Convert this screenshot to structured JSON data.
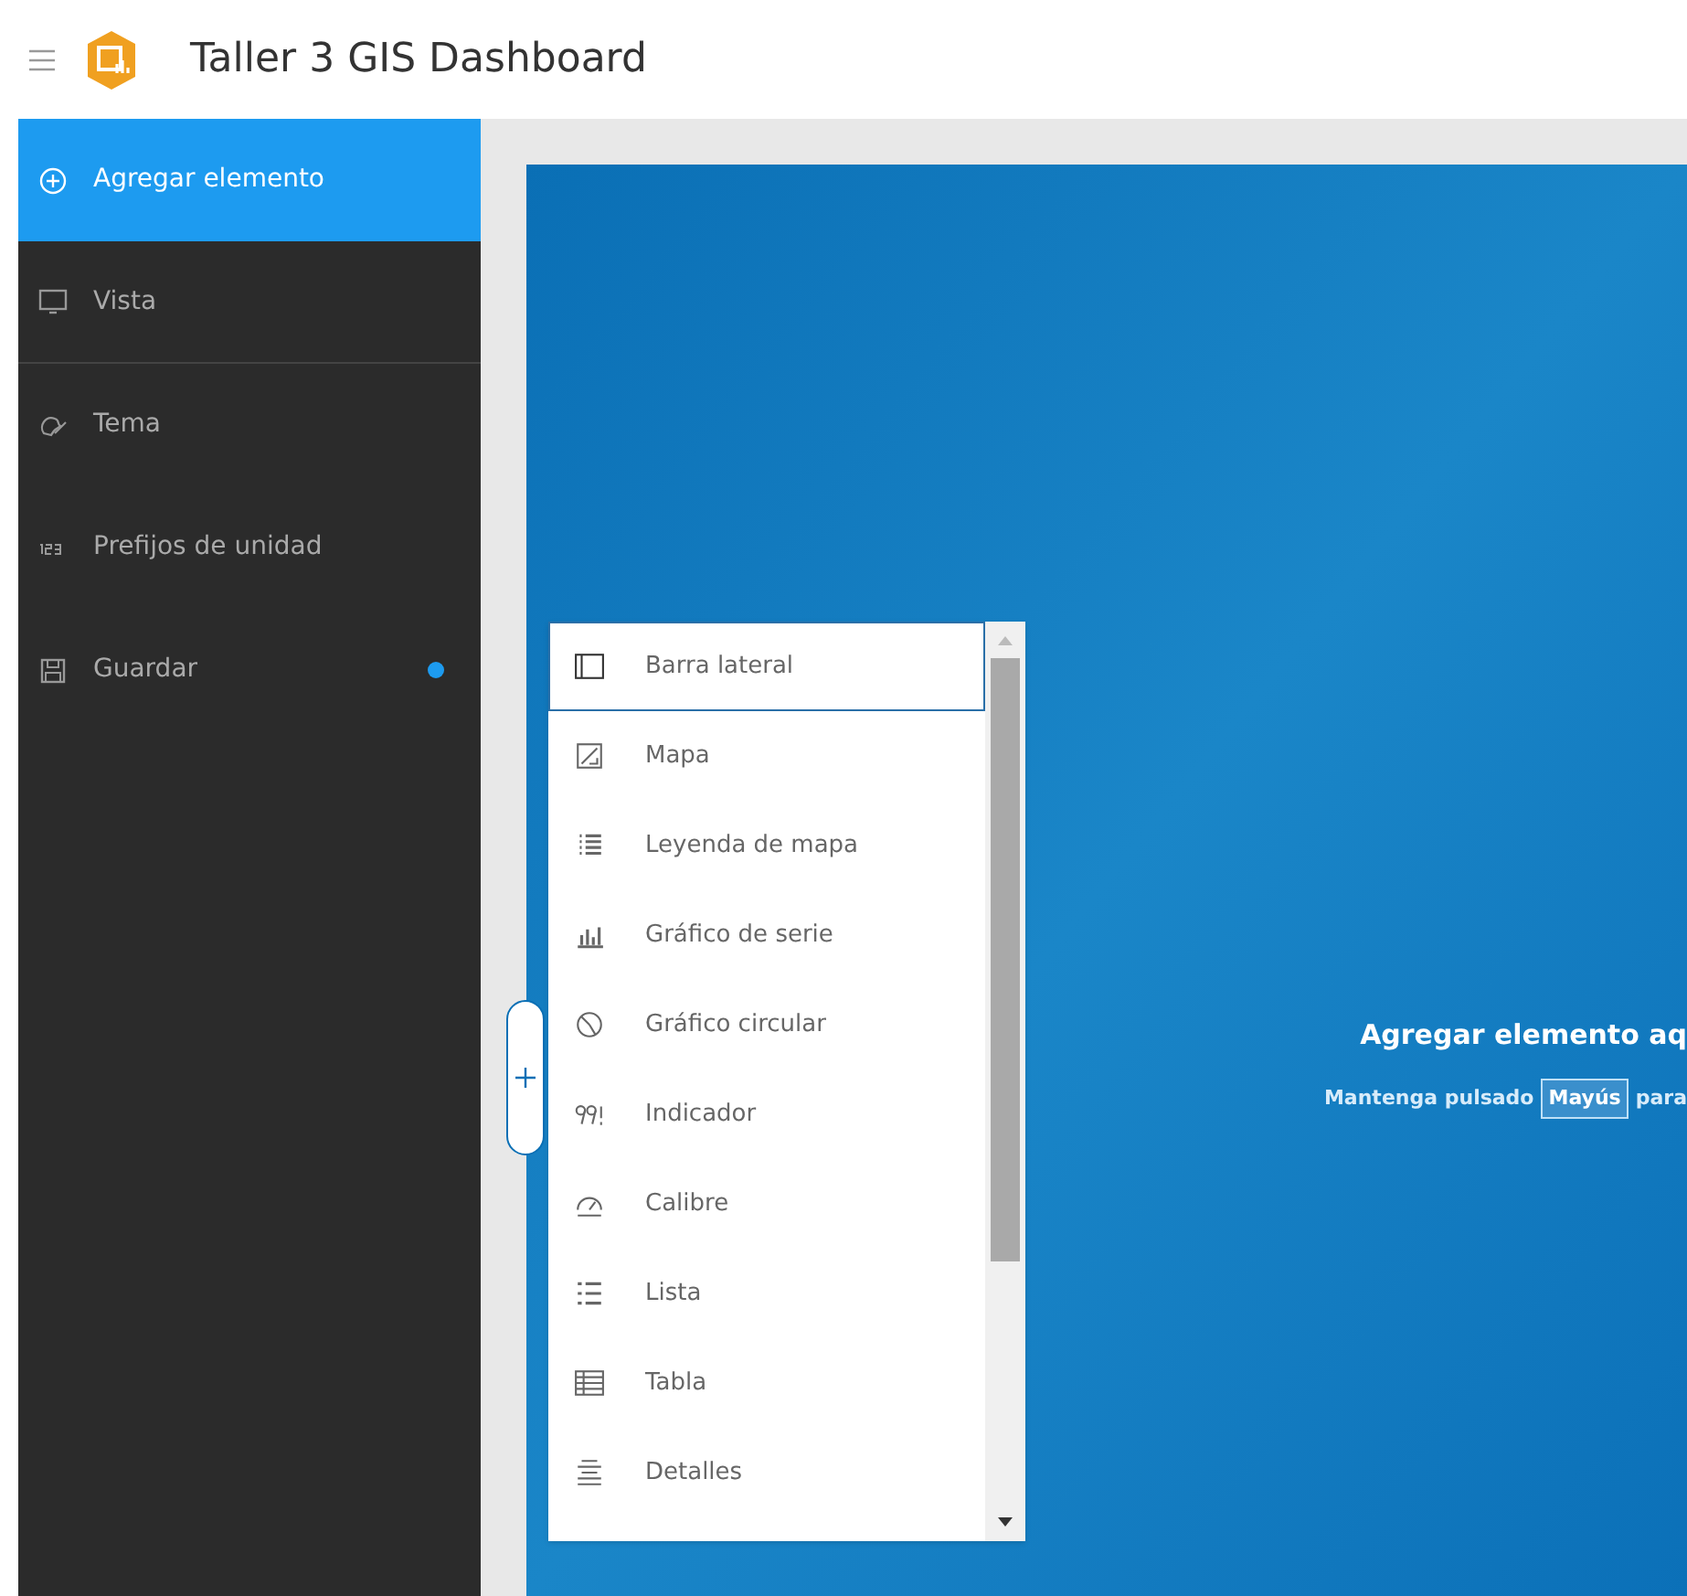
{
  "header": {
    "title": "Taller 3 GIS Dashboard"
  },
  "sidebar": {
    "items": [
      {
        "label": "Agregar elemento",
        "kind": "plus",
        "selected": true,
        "unsaved": false
      },
      {
        "label": "Vista",
        "kind": "monitor",
        "selected": false,
        "unsaved": false
      },
      {
        "label": "Tema",
        "kind": "palette",
        "selected": false,
        "unsaved": false
      },
      {
        "label": "Prefijos de unidad",
        "kind": "digits",
        "selected": false,
        "unsaved": false
      },
      {
        "label": "Guardar",
        "kind": "save",
        "selected": false,
        "unsaved": true
      }
    ]
  },
  "canvas": {
    "drop_title": "Agregar elemento aq",
    "hint_before": "Mantenga pulsado",
    "key": "Mayús",
    "hint_after": "para"
  },
  "element_menu": {
    "items": [
      {
        "label": "Barra lateral",
        "kind": "sidebar",
        "selected": true
      },
      {
        "label": "Mapa",
        "kind": "map",
        "selected": false
      },
      {
        "label": "Leyenda de mapa",
        "kind": "legend",
        "selected": false
      },
      {
        "label": "Gráfico de serie",
        "kind": "bars",
        "selected": false
      },
      {
        "label": "Gráfico circular",
        "kind": "pie",
        "selected": false
      },
      {
        "label": "Indicador",
        "kind": "indicator",
        "selected": false
      },
      {
        "label": "Calibre",
        "kind": "gauge",
        "selected": false
      },
      {
        "label": "Lista",
        "kind": "list",
        "selected": false
      },
      {
        "label": "Tabla",
        "kind": "table",
        "selected": false
      },
      {
        "label": "Detalles",
        "kind": "details",
        "selected": false
      }
    ]
  }
}
